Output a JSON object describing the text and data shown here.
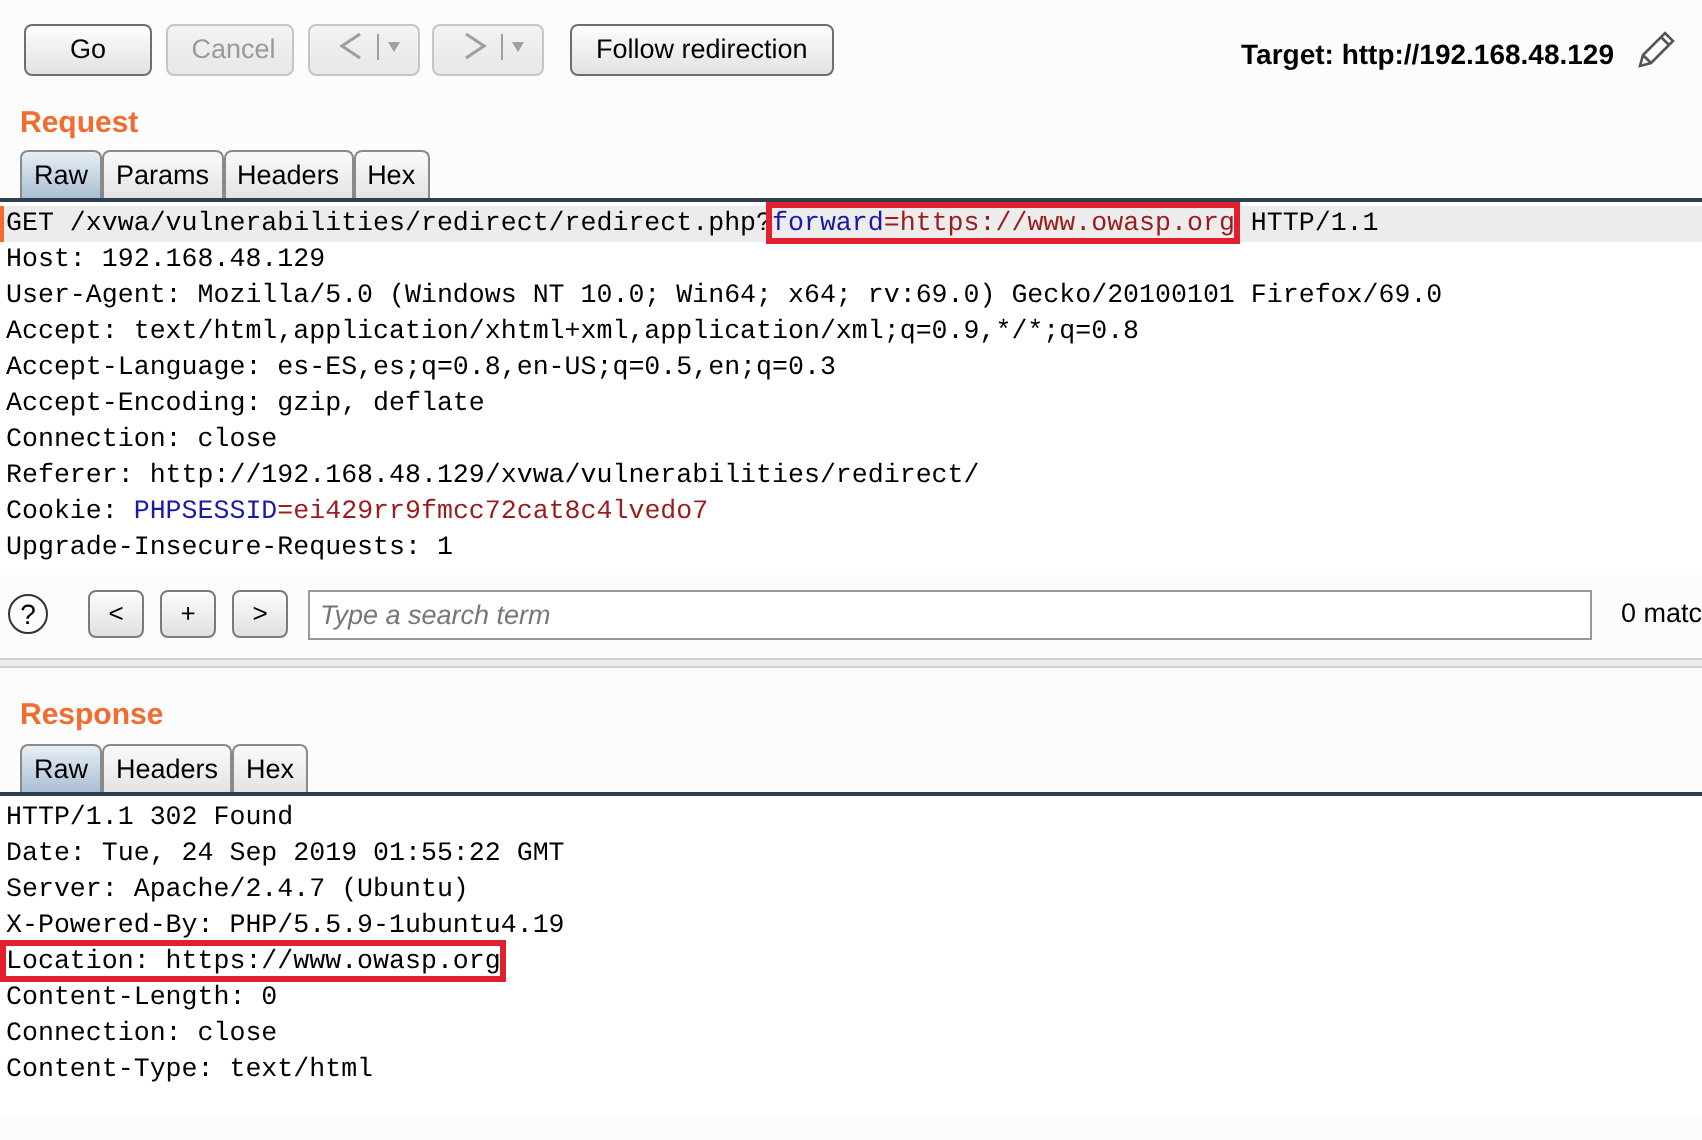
{
  "toolbar": {
    "buttons": [
      {
        "kind": "text",
        "label": "Go",
        "disabled": false
      },
      {
        "kind": "text",
        "label": "Cancel",
        "disabled": true
      },
      {
        "kind": "back",
        "disabled": true
      },
      {
        "kind": "forward",
        "disabled": true
      },
      {
        "kind": "text",
        "label": "Follow redirection",
        "disabled": false
      }
    ],
    "target": "Target: http://192.168.48.129"
  },
  "request": {
    "title": "Request",
    "tabs": [
      {
        "label": "Raw",
        "selected": true
      },
      {
        "label": "Params",
        "selected": false
      },
      {
        "label": "Headers",
        "selected": false
      },
      {
        "label": "Hex",
        "selected": false
      }
    ],
    "lines": [
      {
        "current": true,
        "segments": [
          {
            "kind": "text",
            "text": "GET /xvwa/vulnerabilities/redirect/redirect.php?"
          },
          {
            "kind": "box",
            "parts": [
              {
                "kind": "name",
                "text": "forward"
              },
              {
                "kind": "value",
                "text": "=https://www.owasp.org"
              }
            ]
          },
          {
            "kind": "text",
            "text": " HTTP/1.1"
          }
        ]
      },
      {
        "current": false,
        "segments": [
          {
            "kind": "text",
            "text": "Host: 192.168.48.129"
          }
        ]
      },
      {
        "current": false,
        "segments": [
          {
            "kind": "text",
            "text": "User-Agent: Mozilla/5.0 (Windows NT 10.0; Win64; x64; rv:69.0) Gecko/20100101 Firefox/69.0"
          }
        ]
      },
      {
        "current": false,
        "segments": [
          {
            "kind": "text",
            "text": "Accept: text/html,application/xhtml+xml,application/xml;q=0.9,*/*;q=0.8"
          }
        ]
      },
      {
        "current": false,
        "segments": [
          {
            "kind": "text",
            "text": "Accept-Language: es-ES,es;q=0.8,en-US;q=0.5,en;q=0.3"
          }
        ]
      },
      {
        "current": false,
        "segments": [
          {
            "kind": "text",
            "text": "Accept-Encoding: gzip, deflate"
          }
        ]
      },
      {
        "current": false,
        "segments": [
          {
            "kind": "text",
            "text": "Connection: close"
          }
        ]
      },
      {
        "current": false,
        "segments": [
          {
            "kind": "text",
            "text": "Referer: http://192.168.48.129/xvwa/vulnerabilities/redirect/"
          }
        ]
      },
      {
        "current": false,
        "segments": [
          {
            "kind": "text",
            "text": "Cookie: "
          },
          {
            "kind": "name",
            "text": "PHPSESSID"
          },
          {
            "kind": "value",
            "text": "=ei429rr9fmcc72cat8c4lvedo7"
          }
        ]
      },
      {
        "current": false,
        "segments": [
          {
            "kind": "text",
            "text": "Upgrade-Insecure-Requests: 1"
          }
        ]
      }
    ],
    "search": {
      "help": "?",
      "buttons": [
        "<",
        "+",
        ">"
      ],
      "placeholder": "Type a search term",
      "matches": "0 matc"
    }
  },
  "response": {
    "title": "Response",
    "tabs": [
      {
        "label": "Raw",
        "selected": true
      },
      {
        "label": "Headers",
        "selected": false
      },
      {
        "label": "Hex",
        "selected": false
      }
    ],
    "lines": [
      {
        "current": false,
        "segments": [
          {
            "kind": "text",
            "text": "HTTP/1.1 302 Found"
          }
        ]
      },
      {
        "current": false,
        "segments": [
          {
            "kind": "text",
            "text": "Date: Tue, 24 Sep 2019 01:55:22 GMT"
          }
        ]
      },
      {
        "current": false,
        "segments": [
          {
            "kind": "text",
            "text": "Server: Apache/2.4.7 (Ubuntu)"
          }
        ]
      },
      {
        "current": false,
        "segments": [
          {
            "kind": "text",
            "text": "X-Powered-By: PHP/5.5.9-1ubuntu4.19"
          }
        ]
      },
      {
        "current": false,
        "segments": [
          {
            "kind": "box",
            "parts": [
              {
                "kind": "text",
                "text": "Location: https://www.owasp.org"
              }
            ]
          }
        ]
      },
      {
        "current": false,
        "segments": [
          {
            "kind": "text",
            "text": "Content-Length: 0"
          }
        ]
      },
      {
        "current": false,
        "segments": [
          {
            "kind": "text",
            "text": "Connection: close"
          }
        ]
      },
      {
        "current": false,
        "segments": [
          {
            "kind": "text",
            "text": "Content-Type: text/html"
          }
        ]
      }
    ]
  }
}
